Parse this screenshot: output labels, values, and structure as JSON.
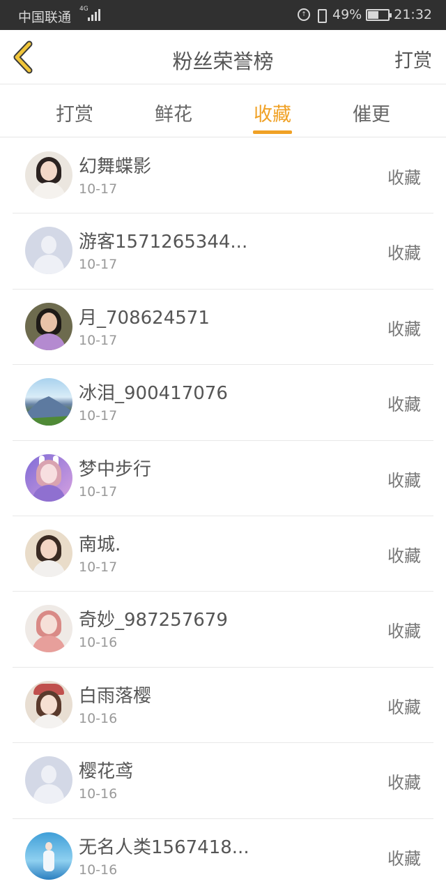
{
  "status_bar": {
    "carrier": "中国联通",
    "network": "4G",
    "battery": "49%",
    "time": "21:32",
    "battery_level": 0.49
  },
  "header": {
    "title": "粉丝荣誉榜",
    "action_label": "打赏"
  },
  "tabs": [
    {
      "label": "打赏",
      "active": false
    },
    {
      "label": "鲜花",
      "active": false
    },
    {
      "label": "收藏",
      "active": true
    },
    {
      "label": "催更",
      "active": false
    }
  ],
  "accent_color": "#f0a125",
  "list": [
    {
      "name": "幻舞蝶影",
      "date": "10-17",
      "type": "收藏",
      "avatar": "photo-girl"
    },
    {
      "name": "游客1571265344...",
      "date": "10-17",
      "type": "收藏",
      "avatar": "default-user"
    },
    {
      "name": "月_708624571",
      "date": "10-17",
      "type": "收藏",
      "avatar": "photo-woman"
    },
    {
      "name": "冰泪_900417076",
      "date": "10-17",
      "type": "收藏",
      "avatar": "photo-mountain"
    },
    {
      "name": "梦中步行",
      "date": "10-17",
      "type": "收藏",
      "avatar": "photo-bunny-girl"
    },
    {
      "name": "南城.",
      "date": "10-17",
      "type": "收藏",
      "avatar": "photo-child"
    },
    {
      "name": "奇妙_987257679",
      "date": "10-16",
      "type": "收藏",
      "avatar": "photo-illustration"
    },
    {
      "name": "白雨落樱",
      "date": "10-16",
      "type": "收藏",
      "avatar": "photo-girl-hat"
    },
    {
      "name": "樱花鸢",
      "date": "10-16",
      "type": "收藏",
      "avatar": "default-user"
    },
    {
      "name": "无名人类1567418...",
      "date": "10-16",
      "type": "收藏",
      "avatar": "photo-sky-girl"
    }
  ]
}
